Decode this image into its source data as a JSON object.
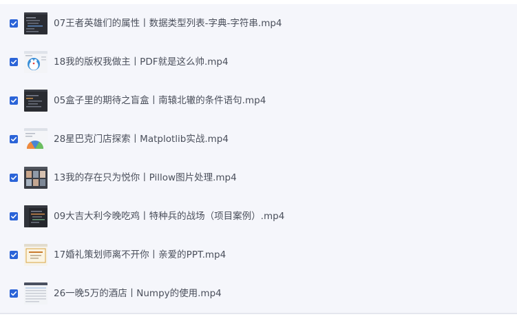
{
  "files": [
    {
      "name": "07王者英雄们的属性丨数据类型列表-字典-字符串.mp4",
      "checked": true,
      "thumb": "dark-code-thumbnail"
    },
    {
      "name": "18我的版权我做主丨PDF就是这么帅.mp4",
      "checked": true,
      "thumb": "doraemon-thumbnail"
    },
    {
      "name": "05盒子里的期待之盲盒丨南辕北辙的条件语句.mp4",
      "checked": true,
      "thumb": "dark-code-thumbnail"
    },
    {
      "name": "28星巴克门店探索丨Matplotlib实战.mp4",
      "checked": true,
      "thumb": "chart-thumbnail"
    },
    {
      "name": "13我的存在只为悦你丨Pillow图片处理.mp4",
      "checked": true,
      "thumb": "photo-grid-thumbnail"
    },
    {
      "name": "09大吉大利今晚吃鸡丨特种兵的战场（项目案例）.mp4",
      "checked": true,
      "thumb": "dark-ide-thumbnail"
    },
    {
      "name": "17婚礼策划师离不开你丨亲爱的PPT.mp4",
      "checked": true,
      "thumb": "certificate-thumbnail"
    },
    {
      "name": "26一晚5万的酒店丨Numpy的使用.mp4",
      "checked": true,
      "thumb": "table-thumbnail"
    }
  ],
  "colors": {
    "checkbox": "#2b64d8",
    "text": "#4a4f5b",
    "panel": "#f5f6fb"
  }
}
